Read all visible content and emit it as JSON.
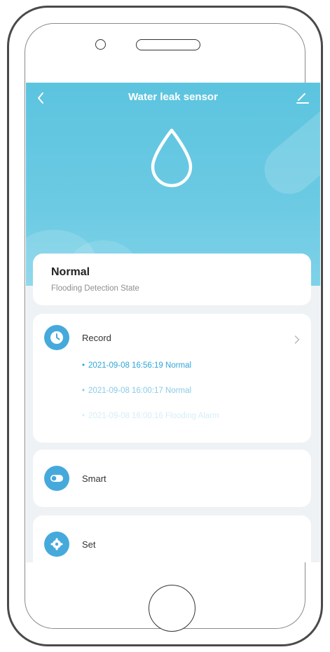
{
  "header": {
    "title": "Water leak sensor"
  },
  "status": {
    "value": "Normal",
    "label": "Flooding Detection State"
  },
  "record": {
    "label": "Record",
    "entries": [
      "2021-09-08 16:56:19 Normal",
      "2021-09-08 16:00:17 Normal",
      "2021-09-08 16:00:16 Flooding Alarm"
    ]
  },
  "smart": {
    "label": "Smart"
  },
  "settings": {
    "label": "Set"
  },
  "colors": {
    "hero": "#5cc4df",
    "accent": "#46a9dc",
    "log_recent": "#2fa6d8"
  },
  "icons": {
    "back": "chevron-left-icon",
    "edit": "pencil-icon",
    "drop": "water-drop-icon",
    "record": "clock-icon",
    "smart": "toggle-icon",
    "settings": "gear-icon",
    "more": "chevron-right-icon"
  }
}
